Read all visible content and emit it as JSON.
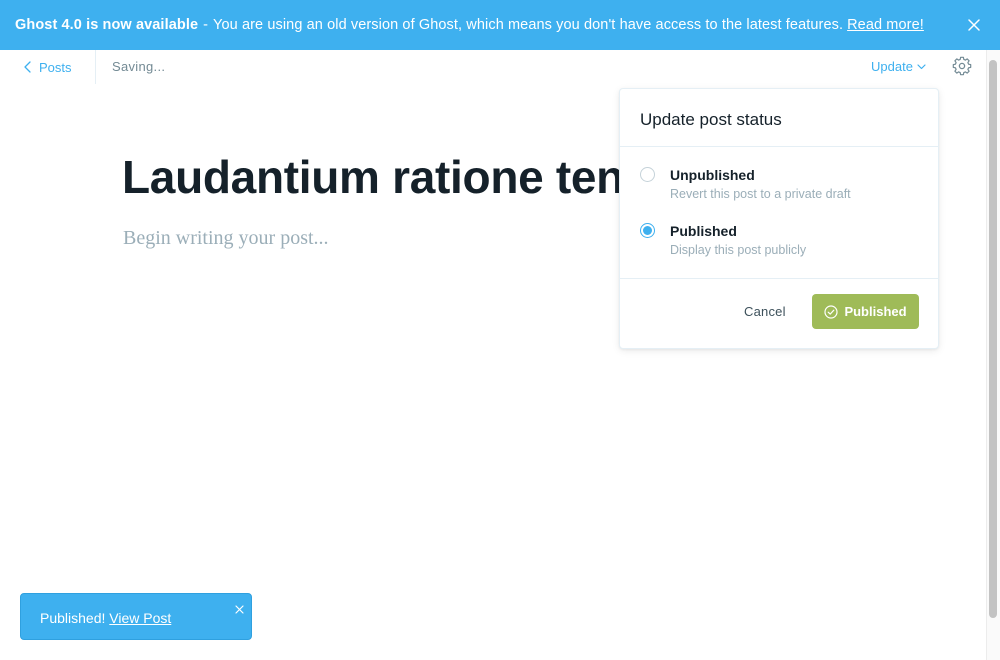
{
  "banner": {
    "title": "Ghost 4.0 is now available",
    "separator": "-",
    "message": "You are using an old version of Ghost, which means you don't have access to the latest features.",
    "link_text": "Read more!",
    "background": "#3eb0ef",
    "close_icon": "close-icon"
  },
  "header": {
    "back_label": "Posts",
    "status": "Saving...",
    "update_label": "Update",
    "settings_icon": "gear-icon"
  },
  "editor": {
    "title": "Laudantium ratione tenetur",
    "body_placeholder": "Begin writing your post..."
  },
  "status_popover": {
    "heading": "Update post status",
    "options": [
      {
        "label": "Unpublished",
        "description": "Revert this post to a private draft",
        "selected": false
      },
      {
        "label": "Published",
        "description": "Display this post publicly",
        "selected": true
      }
    ],
    "cancel_label": "Cancel",
    "confirm_label": "Published",
    "confirm_color": "#9fbb58",
    "accent": "#3eb0ef"
  },
  "toast": {
    "message": "Published!",
    "link_text": "View Post",
    "close_icon": "close-icon"
  }
}
